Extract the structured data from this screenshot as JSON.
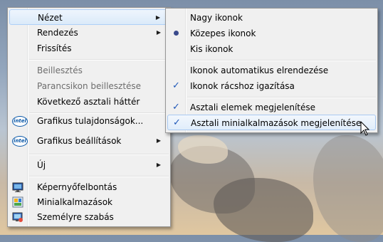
{
  "context_menu": {
    "items": [
      {
        "label": "Nézet",
        "has_submenu": true,
        "enabled": true
      },
      {
        "label": "Rendezés",
        "has_submenu": true,
        "enabled": true
      },
      {
        "label": "Frissítés",
        "has_submenu": false,
        "enabled": true
      },
      {
        "label": "Beillesztés",
        "has_submenu": false,
        "enabled": false
      },
      {
        "label": "Parancsikon beillesztése",
        "has_submenu": false,
        "enabled": false
      },
      {
        "label": "Következő asztali háttér",
        "has_submenu": false,
        "enabled": true
      },
      {
        "label": "Grafikus tulajdonságok...",
        "has_submenu": false,
        "enabled": true,
        "icon": "intel-icon"
      },
      {
        "label": "Grafikus beállítások",
        "has_submenu": true,
        "enabled": true,
        "icon": "intel-icon"
      },
      {
        "label": "Új",
        "has_submenu": true,
        "enabled": true
      },
      {
        "label": "Képernyőfelbontás",
        "has_submenu": false,
        "enabled": true,
        "icon": "display-icon"
      },
      {
        "label": "Minialkalmazások",
        "has_submenu": false,
        "enabled": true,
        "icon": "gadgets-icon"
      },
      {
        "label": "Személyre szabás",
        "has_submenu": false,
        "enabled": true,
        "icon": "personalize-icon"
      }
    ]
  },
  "view_submenu": {
    "items": [
      {
        "label": "Nagy ikonok",
        "state": "none"
      },
      {
        "label": "Közepes ikonok",
        "state": "radio"
      },
      {
        "label": "Kis ikonok",
        "state": "none"
      },
      {
        "label": "Ikonok automatikus elrendezése",
        "state": "none"
      },
      {
        "label": "Ikonok rácshoz igazítása",
        "state": "check"
      },
      {
        "label": "Asztali elemek megjelenítése",
        "state": "check"
      },
      {
        "label": "Asztali minialkalmazások megjelenítése",
        "state": "check"
      }
    ]
  },
  "glyphs": {
    "submenu_arrow": "▶",
    "check": "✓",
    "intel": "intel"
  },
  "colors": {
    "menu_bg": "#f0f0f0",
    "highlight_border": "#aecff7",
    "check": "#1e57b8"
  }
}
